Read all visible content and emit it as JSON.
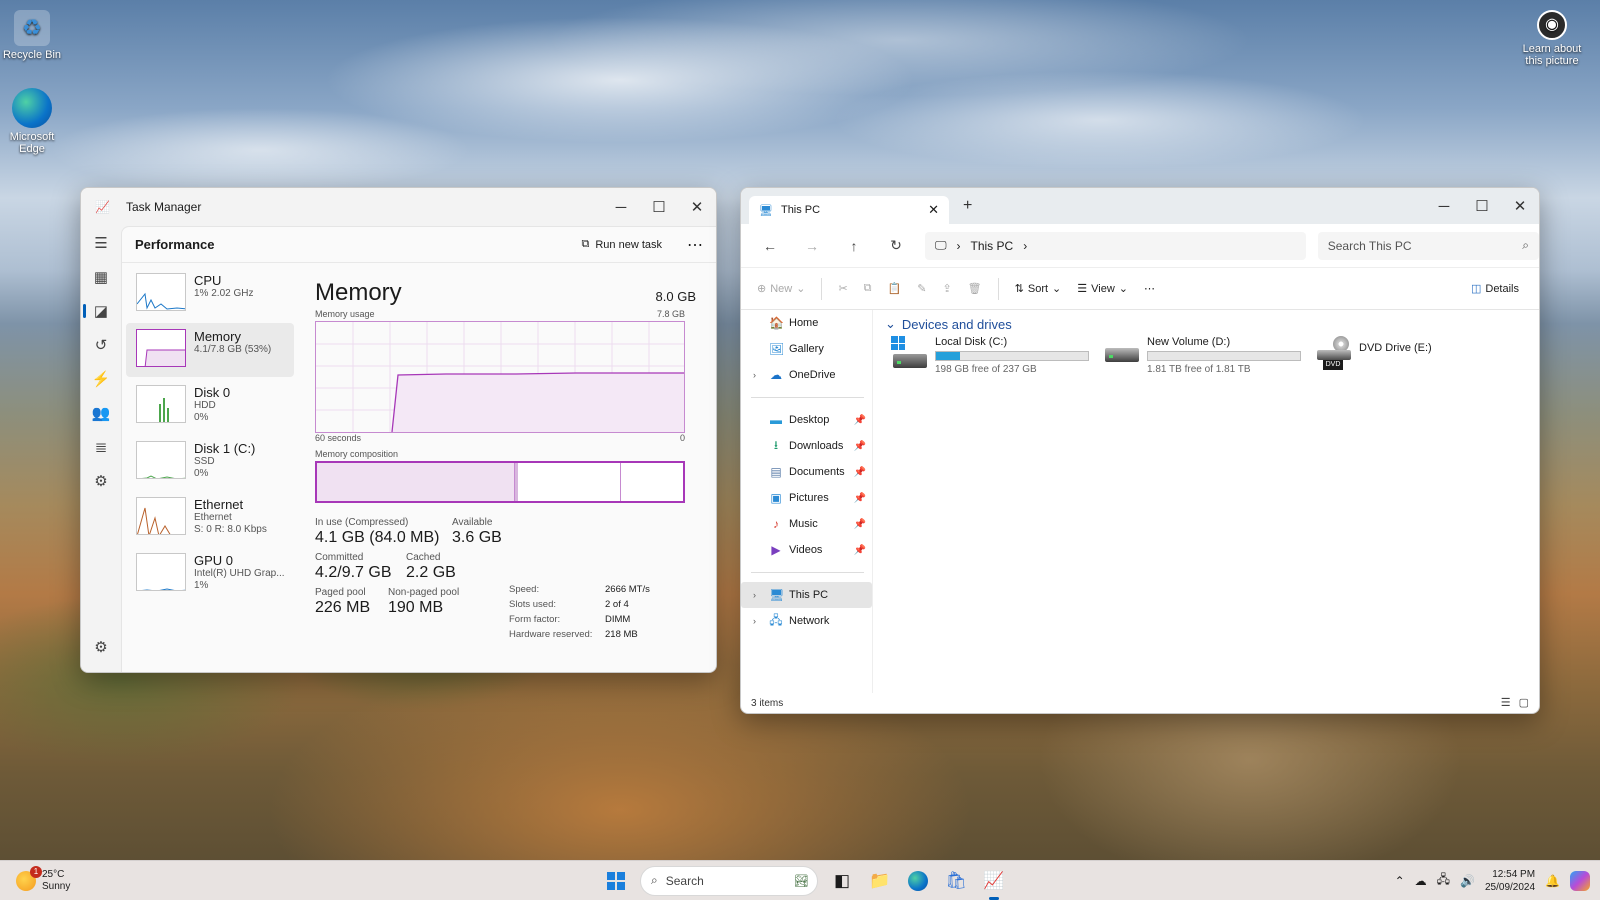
{
  "desktop": {
    "icons": [
      {
        "label": "Recycle Bin",
        "icon": "recycle-bin-icon"
      },
      {
        "label": "Microsoft Edge",
        "icon": "edge-icon"
      }
    ],
    "learn_about": "Learn about this picture"
  },
  "task_manager": {
    "title": "Task Manager",
    "section": "Performance",
    "run_new_task": "Run new task",
    "more": "⋯",
    "perf_items": [
      {
        "name": "CPU",
        "sub1": "1% 2.02 GHz",
        "sub2": ""
      },
      {
        "name": "Memory",
        "sub1": "4.1/7.8 GB (53%)",
        "sub2": ""
      },
      {
        "name": "Disk 0",
        "sub1": "HDD",
        "sub2": "0%"
      },
      {
        "name": "Disk 1 (C:)",
        "sub1": "SSD",
        "sub2": "0%"
      },
      {
        "name": "Ethernet",
        "sub1": "Ethernet",
        "sub2": "S: 0 R: 8.0 Kbps"
      },
      {
        "name": "GPU 0",
        "sub1": "Intel(R) UHD Grap...",
        "sub2": "1%"
      }
    ],
    "memory": {
      "title": "Memory",
      "total": "8.0 GB",
      "usage_label": "Memory usage",
      "usage_max": "7.8 GB",
      "time_left": "60 seconds",
      "time_right": "0",
      "composition_label": "Memory composition",
      "in_use_label": "In use (Compressed)",
      "in_use": "4.1 GB (84.0 MB)",
      "available_label": "Available",
      "available": "3.6 GB",
      "committed_label": "Committed",
      "committed": "4.2/9.7 GB",
      "cached_label": "Cached",
      "cached": "2.2 GB",
      "paged_label": "Paged pool",
      "paged": "226 MB",
      "nonpaged_label": "Non-paged pool",
      "nonpaged": "190 MB",
      "speed_label": "Speed:",
      "speed": "2666 MT/s",
      "slots_label": "Slots used:",
      "slots": "2 of 4",
      "form_label": "Form factor:",
      "form": "DIMM",
      "hwres_label": "Hardware reserved:",
      "hwres": "218 MB"
    }
  },
  "explorer": {
    "tab_title": "This PC",
    "breadcrumb": "This PC",
    "search_placeholder": "Search This PC",
    "cmd": {
      "new": "New",
      "sort": "Sort",
      "view": "View",
      "details": "Details"
    },
    "nav": {
      "home": "Home",
      "gallery": "Gallery",
      "onedrive": "OneDrive",
      "desktop": "Desktop",
      "downloads": "Downloads",
      "documents": "Documents",
      "pictures": "Pictures",
      "music": "Music",
      "videos": "Videos",
      "thispc": "This PC",
      "network": "Network"
    },
    "group": "Devices and drives",
    "drives": [
      {
        "name": "Local Disk (C:)",
        "free": "198 GB free of 237 GB",
        "used_fraction": 0.16
      },
      {
        "name": "New Volume (D:)",
        "free": "1.81 TB free of 1.81 TB",
        "used_fraction": 0.0
      },
      {
        "name": "DVD Drive (E:)",
        "dvd_label": "DVD"
      }
    ],
    "status": "3 items"
  },
  "taskbar": {
    "temp": "25°C",
    "cond": "Sunny",
    "weather_badge": "1",
    "search": "Search",
    "time": "12:54 PM",
    "date": "25/09/2024"
  },
  "colors": {
    "accent": "#005fb8",
    "memory": "#a737b8",
    "drive_fill": "#26a0da"
  }
}
